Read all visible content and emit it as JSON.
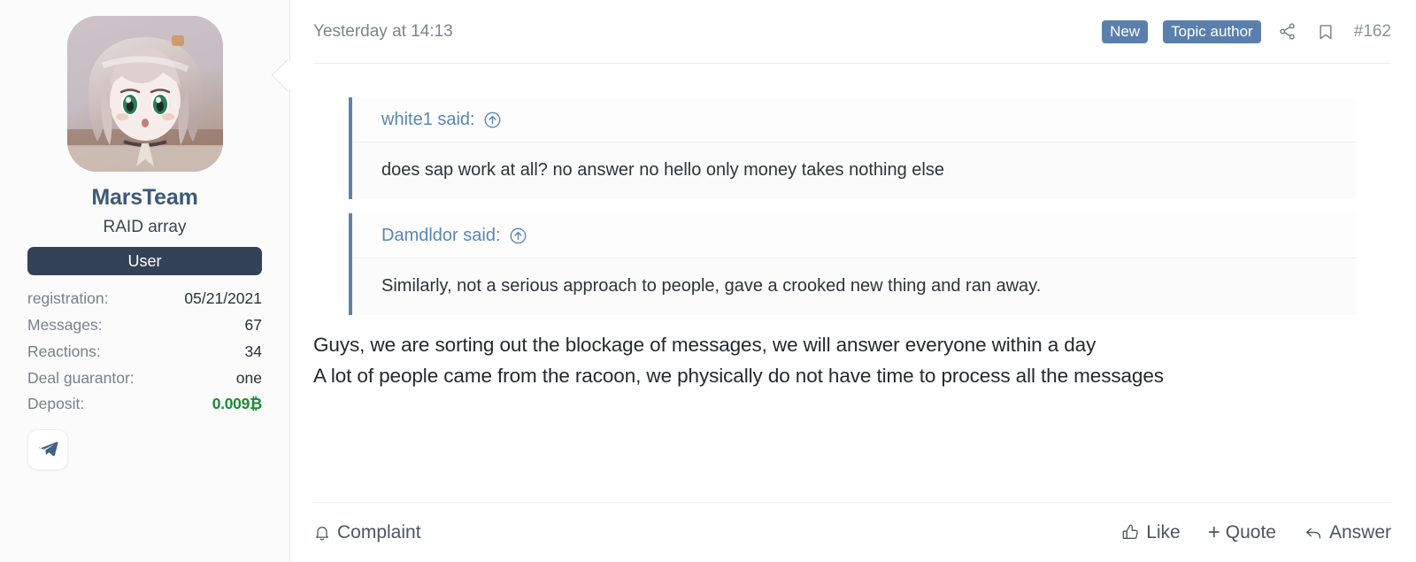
{
  "sidebar": {
    "avatar_alt": "anime-girl-avatar",
    "username": "MarsTeam",
    "user_title": "RAID array",
    "rank_badge": "User",
    "stats": [
      {
        "label": "registration:",
        "value": "05/21/2021",
        "money": false
      },
      {
        "label": "Messages:",
        "value": "67",
        "money": false
      },
      {
        "label": "Reactions:",
        "value": "34",
        "money": false
      },
      {
        "label": "Deal guarantor:",
        "value": "one",
        "money": false
      },
      {
        "label": "Deposit:",
        "value": "0.009₿",
        "money": true
      }
    ],
    "contact_icon": "telegram-icon"
  },
  "post": {
    "date": "Yesterday at 14:13",
    "badges": [
      {
        "label": "New",
        "kind": "new"
      },
      {
        "label": "Topic author",
        "kind": "topic-author"
      }
    ],
    "share_icon": "share-icon",
    "bookmark_icon": "bookmark-icon",
    "post_number": "#162",
    "quotes": [
      {
        "author": "white1 said:",
        "jump_icon": "arrow-up-circle-icon",
        "text": "does sap work at all? no answer no hello only money takes nothing else"
      },
      {
        "author": "Damdldor said:",
        "jump_icon": "arrow-up-circle-icon",
        "text": "Similarly, not a serious approach to people, gave a crooked new thing and ran away."
      }
    ],
    "message_lines": [
      "Guys, we are sorting out the blockage of messages, we will answer everyone within a day",
      "A lot of people came from the racoon, we physically do not have time to process all the messages"
    ],
    "footer": {
      "complaint": "Complaint",
      "like": "Like",
      "quote": "Quote",
      "quote_prefix": "+",
      "answer": "Answer"
    }
  },
  "colors": {
    "accent_blue": "#5b7fad",
    "link_blue": "#5886b5",
    "username_blue": "#3c5a78",
    "rank_dark": "#344257",
    "money_green": "#1a8c32",
    "quote_border": "#5d82ab"
  }
}
